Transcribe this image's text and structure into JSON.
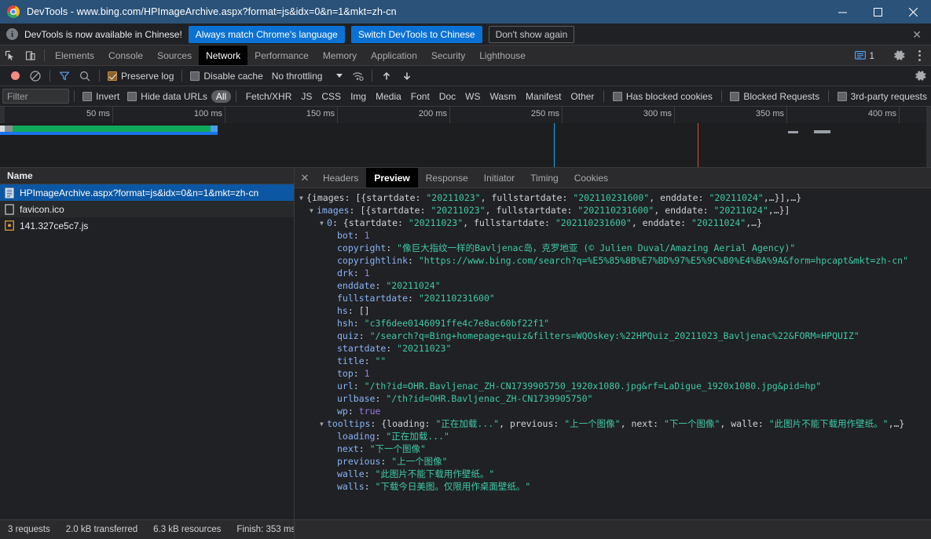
{
  "window": {
    "title": "DevTools - www.bing.com/HPImageArchive.aspx?format=js&idx=0&n=1&mkt=zh-cn",
    "logo_icon": "chrome-logo-icon",
    "minimize_icon": "minimize-icon",
    "maximize_icon": "maximize-icon",
    "close_icon": "close-icon"
  },
  "notification": {
    "info_icon": "info-icon",
    "message": "DevTools is now available in Chinese!",
    "primary_button": "Always match Chrome's language",
    "secondary_button": "Switch DevTools to Chinese",
    "dismiss_button": "Don't show again",
    "close_icon": "close-icon",
    "accent_color": "#0b72d4"
  },
  "tabbar": {
    "inspect_icon": "inspect-element-icon",
    "device_icon": "device-toolbar-icon",
    "tabs": [
      {
        "label": "Elements",
        "active": false
      },
      {
        "label": "Console",
        "active": false
      },
      {
        "label": "Sources",
        "active": false
      },
      {
        "label": "Network",
        "active": true
      },
      {
        "label": "Performance",
        "active": false
      },
      {
        "label": "Memory",
        "active": false
      },
      {
        "label": "Application",
        "active": false
      },
      {
        "label": "Security",
        "active": false
      },
      {
        "label": "Lighthouse",
        "active": false
      }
    ],
    "message_icon": "message-bubble-icon",
    "message_count": "1",
    "settings_icon": "gear-icon",
    "more_icon": "more-vertical-icon"
  },
  "network_toolbar": {
    "record_icon": "record-circle-icon",
    "clear_icon": "clear-no-entry-icon",
    "filter_icon": "funnel-filter-icon",
    "search_icon": "search-icon",
    "preserve_log_label": "Preserve log",
    "preserve_log_checked": true,
    "disable_cache_label": "Disable cache",
    "disable_cache_checked": false,
    "throttling_value": "No throttling",
    "throttling_caret_icon": "chevron-down-icon",
    "wifi_icon": "network-conditions-icon",
    "import_icon": "upload-arrow-icon",
    "export_icon": "download-arrow-icon",
    "settings_icon": "gear-icon"
  },
  "filter_row": {
    "filter_placeholder": "Filter",
    "filter_value": "",
    "invert_label": "Invert",
    "invert_checked": false,
    "hide_data_urls_label": "Hide data URLs",
    "hide_data_urls_checked": false,
    "types": [
      {
        "label": "All",
        "selected": true
      },
      {
        "label": "Fetch/XHR",
        "selected": false
      },
      {
        "label": "JS",
        "selected": false
      },
      {
        "label": "CSS",
        "selected": false
      },
      {
        "label": "Img",
        "selected": false
      },
      {
        "label": "Media",
        "selected": false
      },
      {
        "label": "Font",
        "selected": false
      },
      {
        "label": "Doc",
        "selected": false
      },
      {
        "label": "WS",
        "selected": false
      },
      {
        "label": "Wasm",
        "selected": false
      },
      {
        "label": "Manifest",
        "selected": false
      },
      {
        "label": "Other",
        "selected": false
      }
    ],
    "has_blocked_cookies_label": "Has blocked cookies",
    "has_blocked_cookies_checked": false,
    "blocked_requests_label": "Blocked Requests",
    "blocked_requests_checked": false,
    "third_party_label": "3rd-party requests",
    "third_party_checked": false
  },
  "overview": {
    "ticks": [
      "50 ms",
      "100 ms",
      "150 ms",
      "200 ms",
      "250 ms",
      "300 ms",
      "350 ms",
      "400 ms"
    ],
    "dom_content_loaded_color": "#22a7f0",
    "load_event_color": "#e3453a",
    "bar_colors": {
      "wait": "#8a8d91",
      "receive": "#0fa958",
      "download": "#1a73e8"
    }
  },
  "requests": {
    "column_name": "Name",
    "rows": [
      {
        "name": "HPImageArchive.aspx?format=js&idx=0&n=1&mkt=zh-cn",
        "icon": "document-file-icon",
        "selected": true
      },
      {
        "name": "favicon.ico",
        "icon": "generic-file-icon",
        "selected": false
      },
      {
        "name": "141.327ce5c7.js",
        "icon": "script-file-icon",
        "selected": false
      }
    ]
  },
  "detail_panel": {
    "close_icon": "close-icon",
    "tabs": [
      {
        "label": "Headers",
        "active": false
      },
      {
        "label": "Preview",
        "active": true
      },
      {
        "label": "Response",
        "active": false
      },
      {
        "label": "Initiator",
        "active": false
      },
      {
        "label": "Timing",
        "active": false
      },
      {
        "label": "Cookies",
        "active": false
      }
    ]
  },
  "preview_json": [
    {
      "indent": 0,
      "tri": "▼",
      "parts": [
        {
          "t": "{",
          "c": "p"
        },
        {
          "t": "images",
          "c": "kp"
        },
        {
          "t": ": [{",
          "c": "p"
        },
        {
          "t": "startdate",
          "c": "kp"
        },
        {
          "t": ": ",
          "c": "p"
        },
        {
          "t": "\"20211023\"",
          "c": "s"
        },
        {
          "t": ", ",
          "c": "p"
        },
        {
          "t": "fullstartdate",
          "c": "kp"
        },
        {
          "t": ": ",
          "c": "p"
        },
        {
          "t": "\"202110231600\"",
          "c": "s"
        },
        {
          "t": ", ",
          "c": "p"
        },
        {
          "t": "enddate",
          "c": "kp"
        },
        {
          "t": ": ",
          "c": "p"
        },
        {
          "t": "\"20211024\"",
          "c": "s"
        },
        {
          "t": ",…}],…}",
          "c": "p"
        }
      ]
    },
    {
      "indent": 1,
      "tri": "▼",
      "parts": [
        {
          "t": "images",
          "c": "k"
        },
        {
          "t": ": [{",
          "c": "p"
        },
        {
          "t": "startdate",
          "c": "kp"
        },
        {
          "t": ": ",
          "c": "p"
        },
        {
          "t": "\"20211023\"",
          "c": "s"
        },
        {
          "t": ", ",
          "c": "p"
        },
        {
          "t": "fullstartdate",
          "c": "kp"
        },
        {
          "t": ": ",
          "c": "p"
        },
        {
          "t": "\"202110231600\"",
          "c": "s"
        },
        {
          "t": ", ",
          "c": "p"
        },
        {
          "t": "enddate",
          "c": "kp"
        },
        {
          "t": ": ",
          "c": "p"
        },
        {
          "t": "\"20211024\"",
          "c": "s"
        },
        {
          "t": ",…}]",
          "c": "p"
        }
      ]
    },
    {
      "indent": 2,
      "tri": "▼",
      "parts": [
        {
          "t": "0",
          "c": "k"
        },
        {
          "t": ": {",
          "c": "p"
        },
        {
          "t": "startdate",
          "c": "kp"
        },
        {
          "t": ": ",
          "c": "p"
        },
        {
          "t": "\"20211023\"",
          "c": "s"
        },
        {
          "t": ", ",
          "c": "p"
        },
        {
          "t": "fullstartdate",
          "c": "kp"
        },
        {
          "t": ": ",
          "c": "p"
        },
        {
          "t": "\"202110231600\"",
          "c": "s"
        },
        {
          "t": ", ",
          "c": "p"
        },
        {
          "t": "enddate",
          "c": "kp"
        },
        {
          "t": ": ",
          "c": "p"
        },
        {
          "t": "\"20211024\"",
          "c": "s"
        },
        {
          "t": ",…}",
          "c": "p"
        }
      ]
    },
    {
      "indent": 3,
      "tri": "",
      "parts": [
        {
          "t": "bot",
          "c": "k"
        },
        {
          "t": ": ",
          "c": "p"
        },
        {
          "t": "1",
          "c": "n"
        }
      ]
    },
    {
      "indent": 3,
      "tri": "",
      "parts": [
        {
          "t": "copyright",
          "c": "k"
        },
        {
          "t": ": ",
          "c": "p"
        },
        {
          "t": "\"像巨大指纹一样的Bavljenac岛，克罗地亚 (© Julien Duval/Amazing Aerial Agency)\"",
          "c": "s"
        }
      ]
    },
    {
      "indent": 3,
      "tri": "",
      "parts": [
        {
          "t": "copyrightlink",
          "c": "k"
        },
        {
          "t": ": ",
          "c": "p"
        },
        {
          "t": "\"https://www.bing.com/search?q=%E5%85%8B%E7%BD%97%E5%9C%B0%E4%BA%9A&form=hpcapt&mkt=zh-cn\"",
          "c": "s"
        }
      ]
    },
    {
      "indent": 3,
      "tri": "",
      "parts": [
        {
          "t": "drk",
          "c": "k"
        },
        {
          "t": ": ",
          "c": "p"
        },
        {
          "t": "1",
          "c": "n"
        }
      ]
    },
    {
      "indent": 3,
      "tri": "",
      "parts": [
        {
          "t": "enddate",
          "c": "k"
        },
        {
          "t": ": ",
          "c": "p"
        },
        {
          "t": "\"20211024\"",
          "c": "s"
        }
      ]
    },
    {
      "indent": 3,
      "tri": "",
      "parts": [
        {
          "t": "fullstartdate",
          "c": "k"
        },
        {
          "t": ": ",
          "c": "p"
        },
        {
          "t": "\"202110231600\"",
          "c": "s"
        }
      ]
    },
    {
      "indent": 3,
      "tri": "",
      "parts": [
        {
          "t": "hs",
          "c": "k"
        },
        {
          "t": ": []",
          "c": "p"
        }
      ]
    },
    {
      "indent": 3,
      "tri": "",
      "parts": [
        {
          "t": "hsh",
          "c": "k"
        },
        {
          "t": ": ",
          "c": "p"
        },
        {
          "t": "\"c3f6dee0146091ffe4c7e8ac60bf22f1\"",
          "c": "s"
        }
      ]
    },
    {
      "indent": 3,
      "tri": "",
      "parts": [
        {
          "t": "quiz",
          "c": "k"
        },
        {
          "t": ": ",
          "c": "p"
        },
        {
          "t": "\"/search?q=Bing+homepage+quiz&filters=WQOskey:%22HPQuiz_20211023_Bavljenac%22&FORM=HPQUIZ\"",
          "c": "s"
        }
      ]
    },
    {
      "indent": 3,
      "tri": "",
      "parts": [
        {
          "t": "startdate",
          "c": "k"
        },
        {
          "t": ": ",
          "c": "p"
        },
        {
          "t": "\"20211023\"",
          "c": "s"
        }
      ]
    },
    {
      "indent": 3,
      "tri": "",
      "parts": [
        {
          "t": "title",
          "c": "k"
        },
        {
          "t": ": ",
          "c": "p"
        },
        {
          "t": "\"\"",
          "c": "s"
        }
      ]
    },
    {
      "indent": 3,
      "tri": "",
      "parts": [
        {
          "t": "top",
          "c": "k"
        },
        {
          "t": ": ",
          "c": "p"
        },
        {
          "t": "1",
          "c": "n"
        }
      ]
    },
    {
      "indent": 3,
      "tri": "",
      "parts": [
        {
          "t": "url",
          "c": "k"
        },
        {
          "t": ": ",
          "c": "p"
        },
        {
          "t": "\"/th?id=OHR.Bavljenac_ZH-CN1739905750_1920x1080.jpg&rf=LaDigue_1920x1080.jpg&pid=hp\"",
          "c": "s"
        }
      ]
    },
    {
      "indent": 3,
      "tri": "",
      "parts": [
        {
          "t": "urlbase",
          "c": "k"
        },
        {
          "t": ": ",
          "c": "p"
        },
        {
          "t": "\"/th?id=OHR.Bavljenac_ZH-CN1739905750\"",
          "c": "s"
        }
      ]
    },
    {
      "indent": 3,
      "tri": "",
      "parts": [
        {
          "t": "wp",
          "c": "k"
        },
        {
          "t": ": ",
          "c": "p"
        },
        {
          "t": "true",
          "c": "b"
        }
      ]
    },
    {
      "indent": 2,
      "tri": "▼",
      "parts": [
        {
          "t": "tooltips",
          "c": "k"
        },
        {
          "t": ": {",
          "c": "p"
        },
        {
          "t": "loading",
          "c": "kp"
        },
        {
          "t": ": ",
          "c": "p"
        },
        {
          "t": "\"正在加载...\"",
          "c": "s"
        },
        {
          "t": ", ",
          "c": "p"
        },
        {
          "t": "previous",
          "c": "kp"
        },
        {
          "t": ": ",
          "c": "p"
        },
        {
          "t": "\"上一个图像\"",
          "c": "s"
        },
        {
          "t": ", ",
          "c": "p"
        },
        {
          "t": "next",
          "c": "kp"
        },
        {
          "t": ": ",
          "c": "p"
        },
        {
          "t": "\"下一个图像\"",
          "c": "s"
        },
        {
          "t": ", ",
          "c": "p"
        },
        {
          "t": "walle",
          "c": "kp"
        },
        {
          "t": ": ",
          "c": "p"
        },
        {
          "t": "\"此图片不能下载用作壁纸。\"",
          "c": "s"
        },
        {
          "t": ",…}",
          "c": "p"
        }
      ]
    },
    {
      "indent": 3,
      "tri": "",
      "parts": [
        {
          "t": "loading",
          "c": "k"
        },
        {
          "t": ": ",
          "c": "p"
        },
        {
          "t": "\"正在加载...\"",
          "c": "s"
        }
      ]
    },
    {
      "indent": 3,
      "tri": "",
      "parts": [
        {
          "t": "next",
          "c": "k"
        },
        {
          "t": ": ",
          "c": "p"
        },
        {
          "t": "\"下一个图像\"",
          "c": "s"
        }
      ]
    },
    {
      "indent": 3,
      "tri": "",
      "parts": [
        {
          "t": "previous",
          "c": "k"
        },
        {
          "t": ": ",
          "c": "p"
        },
        {
          "t": "\"上一个图像\"",
          "c": "s"
        }
      ]
    },
    {
      "indent": 3,
      "tri": "",
      "parts": [
        {
          "t": "walle",
          "c": "k"
        },
        {
          "t": ": ",
          "c": "p"
        },
        {
          "t": "\"此图片不能下载用作壁纸。\"",
          "c": "s"
        }
      ]
    },
    {
      "indent": 3,
      "tri": "",
      "parts": [
        {
          "t": "walls",
          "c": "k"
        },
        {
          "t": ": ",
          "c": "p"
        },
        {
          "t": "\"下载今日美图。仅限用作桌面壁纸。\"",
          "c": "s"
        }
      ]
    }
  ],
  "status_bar": {
    "requests": "3 requests",
    "transferred": "2.0 kB transferred",
    "resources": "6.3 kB resources",
    "finish": "Finish: 353 ms"
  }
}
